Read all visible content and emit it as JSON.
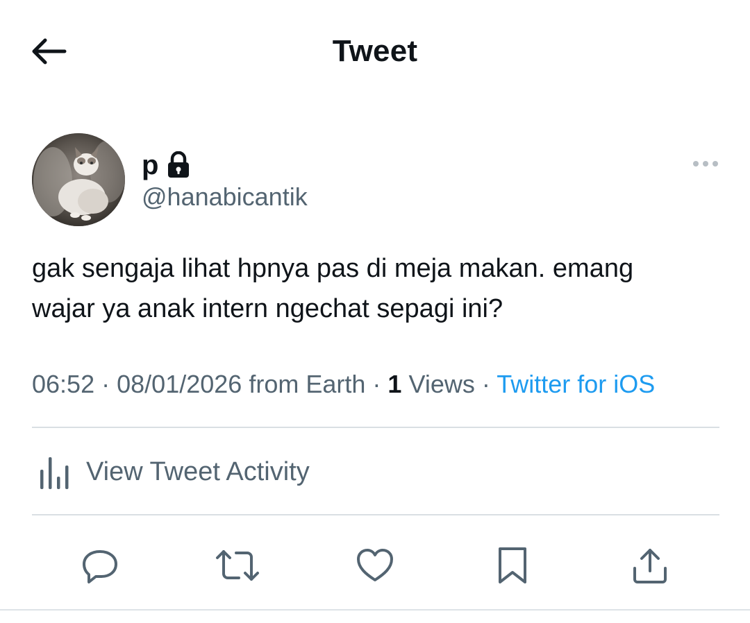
{
  "header": {
    "title": "Tweet",
    "back_icon": "arrow-left-icon"
  },
  "author": {
    "display_name": "p",
    "protected_icon": "lock-icon",
    "username": "@hanabicantik",
    "avatar": "cat-avatar"
  },
  "tweet": {
    "text_lines": [
      "gak sengaja lihat hpnya pas di meja makan. emang",
      "wajar ya anak intern ngechat sepagi ini?"
    ]
  },
  "meta": {
    "time": "06:52",
    "separator": "·",
    "date": "08/01/2026",
    "location": "from Earth",
    "views_count": "1",
    "views_label": "Views",
    "source": "Twitter for iOS"
  },
  "activity": {
    "label": "View Tweet Activity",
    "icon": "bar-chart-icon"
  },
  "actions": {
    "items": [
      "reply-icon",
      "retweet-icon",
      "like-icon",
      "bookmark-icon",
      "share-icon"
    ]
  },
  "colors": {
    "text_primary": "#0f1419",
    "text_secondary": "#536471",
    "link": "#1d9bf0",
    "divider": "#d9dfe3"
  }
}
